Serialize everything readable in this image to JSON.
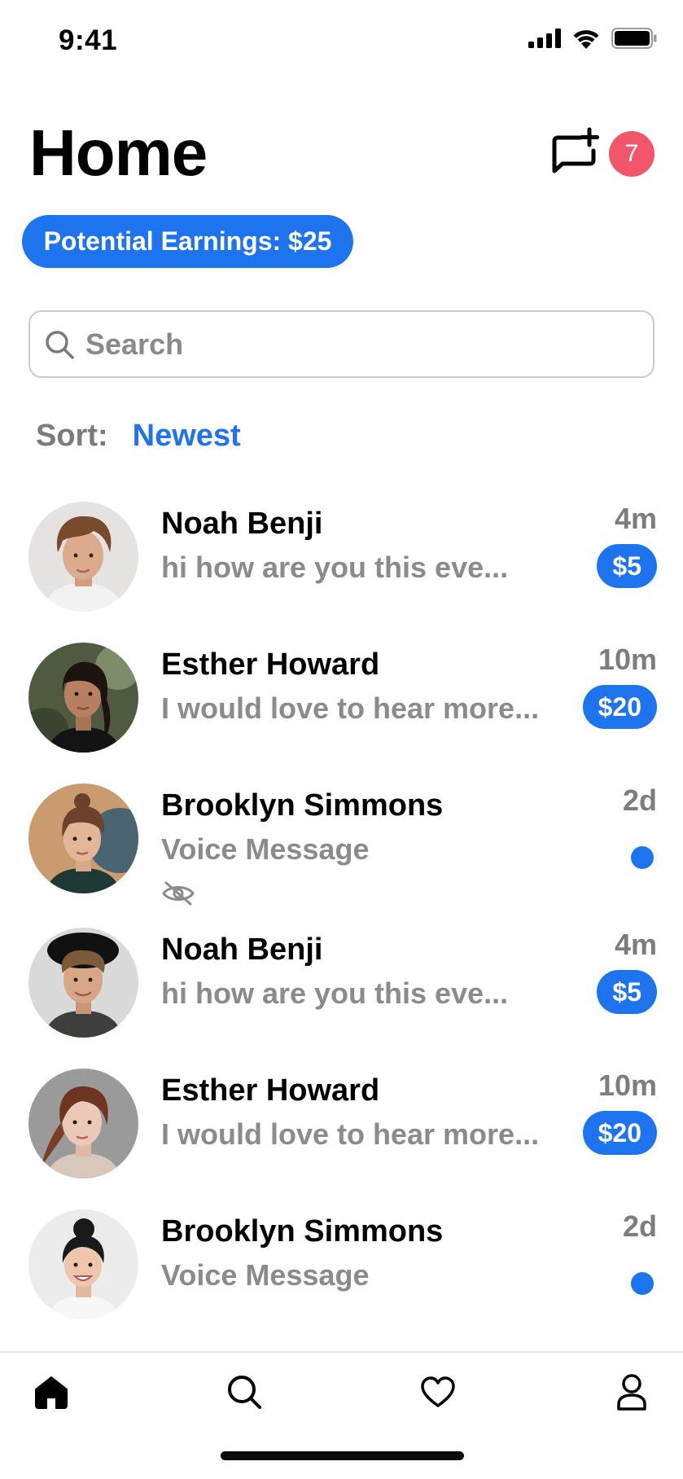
{
  "status_bar": {
    "time": "9:41"
  },
  "header": {
    "title": "Home",
    "notification_count": "7"
  },
  "earnings": {
    "label": "Potential Earnings: $25"
  },
  "search": {
    "placeholder": "Search"
  },
  "sort": {
    "label": "Sort:",
    "value": "Newest"
  },
  "conversations": [
    {
      "name": "Noah Benji",
      "preview": "hi how are you this eve...",
      "time": "4m",
      "amount": "$5"
    },
    {
      "name": "Esther Howard",
      "preview": "I would love to hear more...",
      "time": "10m",
      "amount": "$20"
    },
    {
      "name": "Brooklyn Simmons",
      "preview": "Voice Message",
      "time": "2d",
      "unread": true,
      "hidden_icon": "eye-off-icon"
    },
    {
      "name": "Noah Benji",
      "preview": "hi how are you this eve...",
      "time": "4m",
      "amount": "$5"
    },
    {
      "name": "Esther Howard",
      "preview": "I would love to hear more...",
      "time": "10m",
      "amount": "$20"
    },
    {
      "name": "Brooklyn Simmons",
      "preview": "Voice Message",
      "time": "2d",
      "unread": true
    }
  ],
  "tabs": [
    {
      "icon": "home-icon",
      "active": true
    },
    {
      "icon": "search-icon"
    },
    {
      "icon": "heart-icon"
    },
    {
      "icon": "profile-icon"
    }
  ],
  "colors": {
    "accent": "#1e74ee",
    "badge_red": "#f2566a",
    "muted_text": "#8b8b8b"
  }
}
